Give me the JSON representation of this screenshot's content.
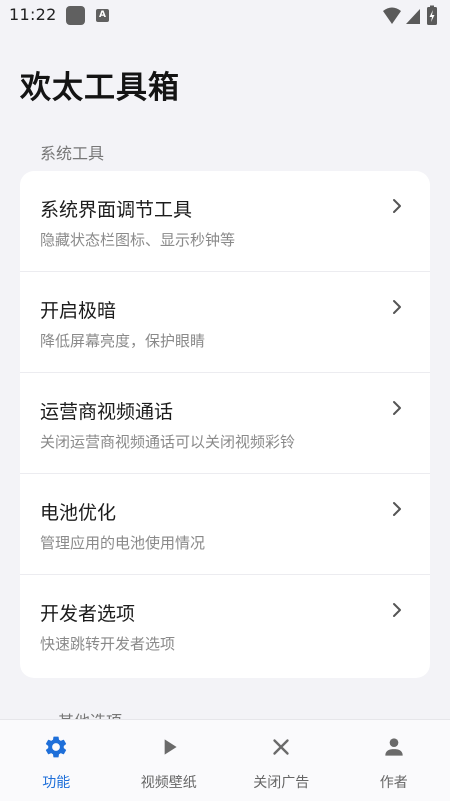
{
  "status_bar": {
    "time": "11:22",
    "notification_icons": [
      "app-square-icon",
      "font-a-icon"
    ],
    "a_glyph": "A",
    "right_icons": [
      "wifi-icon",
      "cell-signal-icon",
      "battery-charging-icon"
    ]
  },
  "app": {
    "title": "欢太工具箱"
  },
  "sections": {
    "system_tools": "系统工具",
    "other_options": "其他选项"
  },
  "items": [
    {
      "title": "系统界面调节工具",
      "subtitle": "隐藏状态栏图标、显示秒钟等"
    },
    {
      "title": "开启极暗",
      "subtitle": "降低屏幕亮度，保护眼睛"
    },
    {
      "title": "运营商视频通话",
      "subtitle": "关闭运营商视频通话可以关闭视频彩铃"
    },
    {
      "title": "电池优化",
      "subtitle": "管理应用的电池使用情况"
    },
    {
      "title": "开发者选项",
      "subtitle": "快速跳转开发者选项"
    }
  ],
  "bottom_nav": [
    {
      "label": "功能",
      "icon": "gear-icon",
      "active": true
    },
    {
      "label": "视频壁纸",
      "icon": "play-icon",
      "active": false
    },
    {
      "label": "关闭广告",
      "icon": "close-icon",
      "active": false
    },
    {
      "label": "作者",
      "icon": "person-icon",
      "active": false
    }
  ],
  "colors": {
    "accent": "#1e6fd9",
    "background": "#f3f3f7",
    "card": "#ffffff"
  }
}
